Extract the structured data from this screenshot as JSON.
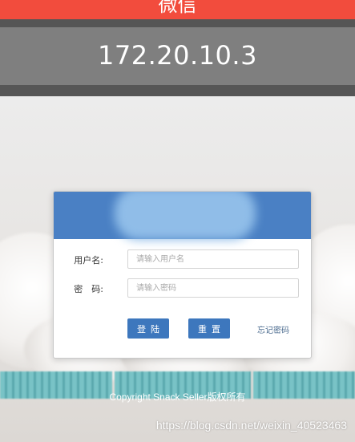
{
  "app_bar": {
    "title": "微信"
  },
  "server": {
    "ip": "172.20.10.3"
  },
  "login_form": {
    "username_label": "用户名:",
    "username_placeholder": "请输入用户名",
    "password_label": "密　码:",
    "password_placeholder": "请输入密码",
    "login_button": "登陆",
    "reset_button": "重置",
    "forgot_link": "忘记密码"
  },
  "footer": {
    "copyright": "Copyright Snack Seller版权所有"
  },
  "watermark": "https://blog.csdn.net/weixin_40523463",
  "colors": {
    "app_bar": "#f24c3d",
    "card_header": "#4a80c4",
    "button": "#3d77bd"
  }
}
